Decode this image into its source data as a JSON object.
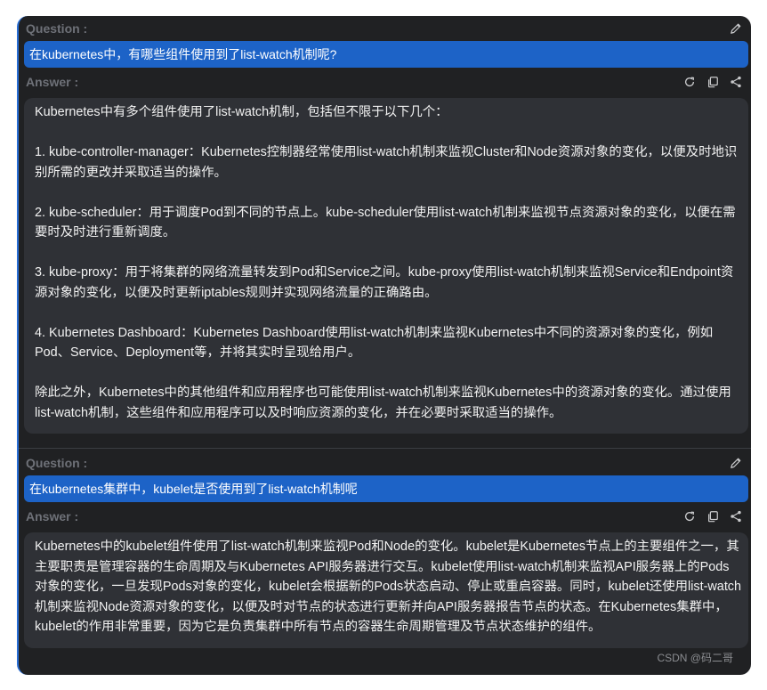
{
  "labels": {
    "question": "Question :",
    "answer": "Answer :"
  },
  "qa": [
    {
      "question": "在kubernetes中，有哪些组件使用到了list-watch机制呢?",
      "answer": [
        "Kubernetes中有多个组件使用了list-watch机制，包括但不限于以下几个：",
        "1. kube-controller-manager：Kubernetes控制器经常使用list-watch机制来监视Cluster和Node资源对象的变化，以便及时地识别所需的更改并采取适当的操作。",
        "2. kube-scheduler：用于调度Pod到不同的节点上。kube-scheduler使用list-watch机制来监视节点资源对象的变化，以便在需要时及时进行重新调度。",
        "3. kube-proxy：用于将集群的网络流量转发到Pod和Service之间。kube-proxy使用list-watch机制来监视Service和Endpoint资源对象的变化，以便及时更新iptables规则并实现网络流量的正确路由。",
        "4. Kubernetes Dashboard：Kubernetes Dashboard使用list-watch机制来监视Kubernetes中不同的资源对象的变化，例如Pod、Service、Deployment等，并将其实时呈现给用户。",
        "除此之外，Kubernetes中的其他组件和应用程序也可能使用list-watch机制来监视Kubernetes中的资源对象的变化。通过使用list-watch机制，这些组件和应用程序可以及时响应资源的变化，并在必要时采取适当的操作。"
      ]
    },
    {
      "question": "在kubernetes集群中，kubelet是否使用到了list-watch机制呢",
      "answer": [
        "Kubernetes中的kubelet组件使用了list-watch机制来监视Pod和Node的变化。kubelet是Kubernetes节点上的主要组件之一，其主要职责是管理容器的生命周期及与Kubernetes API服务器进行交互。kubelet使用list-watch机制来监视API服务器上的Pods对象的变化，一旦发现Pods对象的变化，kubelet会根据新的Pods状态启动、停止或重启容器。同时，kubelet还使用list-watch机制来监视Node资源对象的变化，以便及时对节点的状态进行更新并向API服务器报告节点的状态。在Kubernetes集群中，kubelet的作用非常重要，因为它是负责集群中所有节点的容器生命周期管理及节点状态维护的组件。"
      ]
    }
  ],
  "icons": {
    "edit": "pencil-icon",
    "regenerate": "refresh-icon",
    "copy": "copy-icon",
    "share": "share-icon"
  },
  "watermark": "CSDN @码二哥",
  "colors": {
    "panel": "#202123",
    "question_bar": "#1d63c7",
    "answer_box": "#2f3136",
    "label": "#6e7178",
    "icon": "#c9cacc"
  }
}
